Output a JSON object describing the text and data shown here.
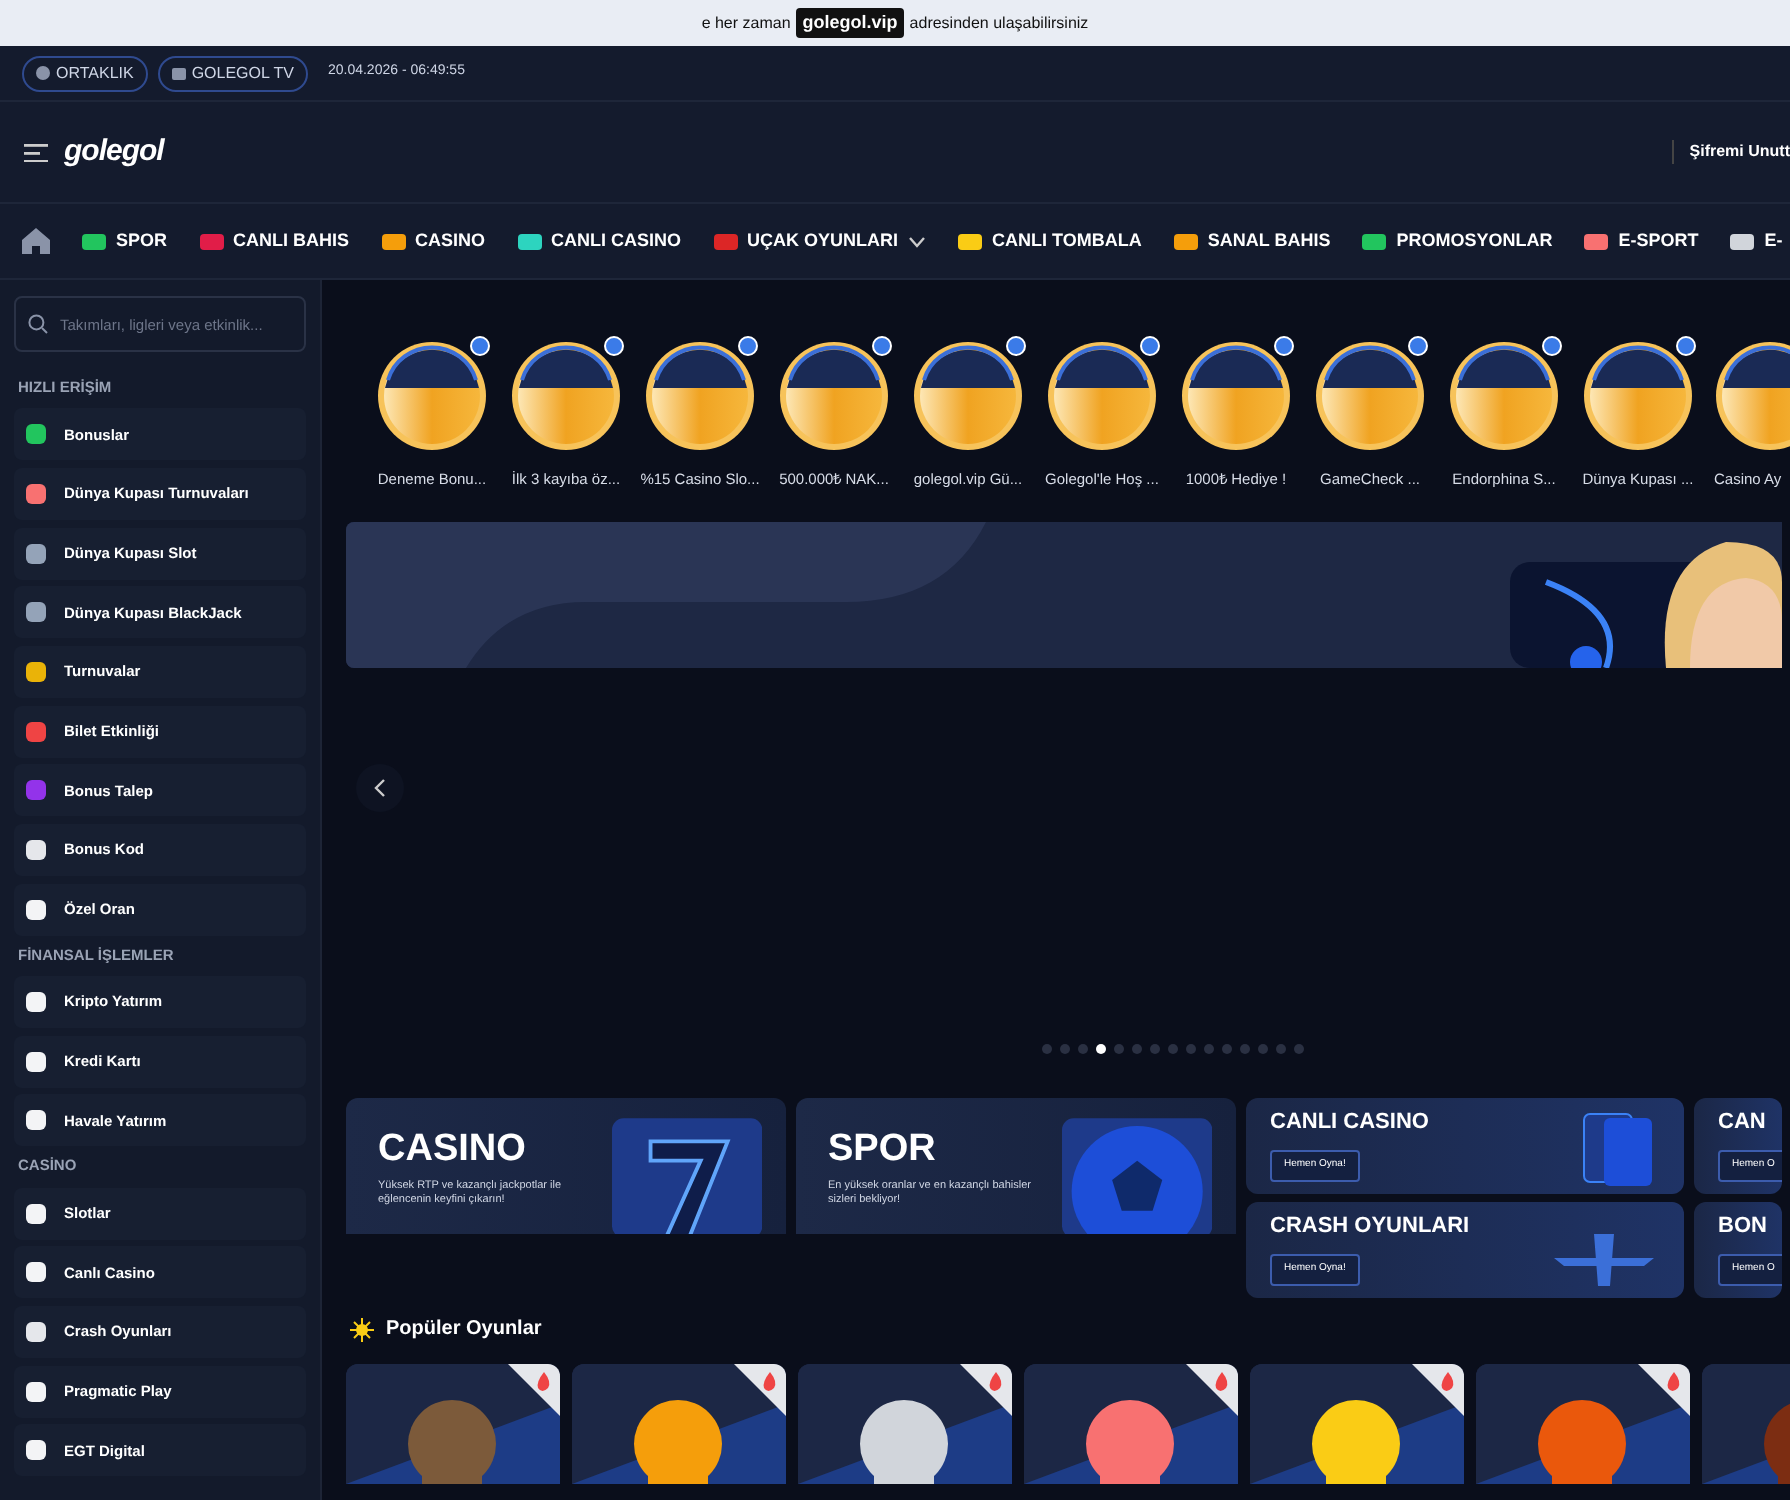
{
  "notice": {
    "before": "e her zaman",
    "highlight": "golegol.vip",
    "after": "adresinden ulaşabilirsiniz"
  },
  "topbar": {
    "pills": [
      "ORTAKLIK",
      "GOLEGOL TV"
    ],
    "datetime": "20.04.2026 - 06:49:55"
  },
  "header": {
    "logo": "golegol",
    "forgot_link": "Şifremi Unutt"
  },
  "nav": [
    {
      "kind": "home"
    },
    {
      "kind": "item",
      "label": "SPOR"
    },
    {
      "kind": "item",
      "label": "CANLI BAHIS"
    },
    {
      "kind": "item",
      "label": "CASINO"
    },
    {
      "kind": "item",
      "label": "CANLI CASINO"
    },
    {
      "kind": "dropdown",
      "label": "UÇAK OYUNLARI"
    },
    {
      "kind": "item",
      "label": "CANLI TOMBALA"
    },
    {
      "kind": "item",
      "label": "SANAL BAHIS"
    },
    {
      "kind": "item",
      "label": "PROMOSYONLAR"
    },
    {
      "kind": "item",
      "label": "E-SPORT"
    },
    {
      "kind": "item",
      "label": "E-"
    }
  ],
  "sidebar": {
    "search": {
      "placeholder": "Takımları, ligleri veya etkinlik..."
    },
    "sections": [
      {
        "title": "HIZLI ERİŞİM",
        "items": [
          "Bonuslar",
          "Dünya Kupası Turnuvaları",
          "Dünya Kupası Slot",
          "Dünya Kupası BlackJack",
          "Turnuvalar",
          "Bilet Etkinliği",
          "Bonus Talep",
          "Bonus Kod",
          "Özel Oran"
        ]
      },
      {
        "title": "FİNANSAL İŞLEMLER",
        "items": [
          "Kripto Yatırım",
          "Kredi Kartı",
          "Havale Yatırım"
        ]
      },
      {
        "title": "CASİNO",
        "items": [
          "Slotlar",
          "Canlı Casino",
          "Crash Oyunları",
          "Pragmatic Play",
          "EGT Digital"
        ]
      }
    ]
  },
  "stories": [
    {
      "label": "Deneme Bonu...",
      "unread": true
    },
    {
      "label": "İlk 3 kayıba öz...",
      "unread": true
    },
    {
      "label": "%15 Casino Slo...",
      "unread": true
    },
    {
      "label": "500.000₺ NAK...",
      "unread": true
    },
    {
      "label": "golegol.vip Gü...",
      "unread": true
    },
    {
      "label": "Golegol'le Hoş ...",
      "unread": true
    },
    {
      "label": "1000₺ Hediye !",
      "unread": true
    },
    {
      "label": "GameCheck ...",
      "unread": true
    },
    {
      "label": "Endorphina S...",
      "unread": true
    },
    {
      "label": "Dünya Kupası ...",
      "unread": true
    },
    {
      "label": "Casino Ay"
    }
  ],
  "carousel": {
    "dots": [
      {
        "selected": false
      },
      {
        "selected": false
      },
      {
        "selected": false
      },
      {
        "selected": true
      },
      {
        "selected": false
      },
      {
        "selected": false
      },
      {
        "selected": false
      },
      {
        "selected": false
      },
      {
        "selected": false
      },
      {
        "selected": false
      },
      {
        "selected": false
      },
      {
        "selected": false
      },
      {
        "selected": false
      },
      {
        "selected": false
      },
      {
        "selected": false
      }
    ]
  },
  "promos": [
    {
      "kind": "large",
      "title": "CASINO",
      "text": "Yüksek RTP ve kazançlı jackpotlar ile eğlencenin keyfini çıkarın!"
    },
    {
      "kind": "large",
      "title": "SPOR",
      "text": "En yüksek oranlar ve en kazançlı bahisler sizleri bekliyor!"
    },
    {
      "kind": "small",
      "title": "CANLI CASINO",
      "button": "Hemen Oyna!"
    },
    {
      "kind": "small",
      "title": "CRASH OYUNLARI",
      "button": "Hemen Oyna!"
    },
    {
      "kind": "small",
      "title": "CAN",
      "button": "Hemen O"
    },
    {
      "kind": "small",
      "title": "BON",
      "button": "Hemen O"
    }
  ],
  "popular": {
    "title": "Popüler Oyunlar",
    "games": [
      {
        "kind": "picture",
        "hot": true
      },
      {
        "kind": "picture",
        "hot": true
      },
      {
        "kind": "picture",
        "hot": true
      },
      {
        "kind": "picture",
        "hot": true
      },
      {
        "kind": "picture",
        "hot": true
      },
      {
        "kind": "picture",
        "hot": true
      },
      {
        "kind": "picture"
      }
    ]
  }
}
